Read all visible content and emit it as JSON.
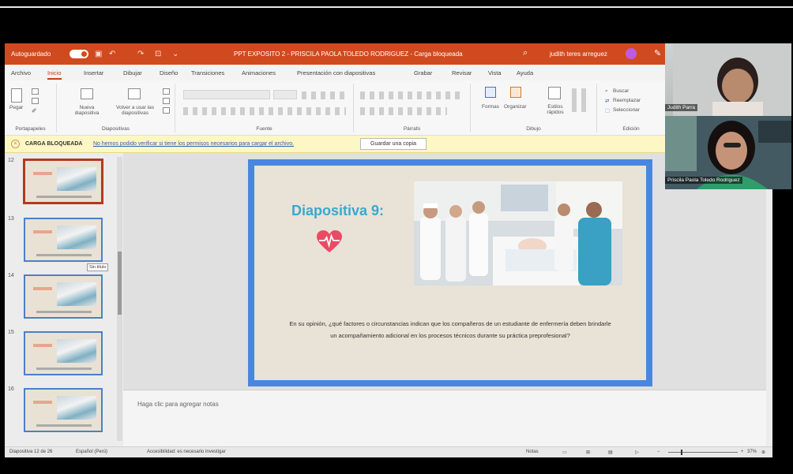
{
  "window": {
    "autosave_label": "Autoguardado",
    "doc_title": "PPT EXPOSITO 2 - PRISCILA PAOLA TOLEDO RODRIGUEZ - Carga bloqueada",
    "user_name": "judith teres arreguez"
  },
  "tabs": [
    "Archivo",
    "Inicio",
    "Insertar",
    "Dibujar",
    "Diseño",
    "Transiciones",
    "Animaciones",
    "Presentación con diapositivas",
    "Grabar",
    "Revisar",
    "Vista",
    "Ayuda"
  ],
  "ribbon": {
    "paste_label": "Pegar",
    "new_slide_label": "Nueva diapositiva",
    "reuse_label": "Volver a usar las diapositivas",
    "forms_label": "Formas",
    "arrange_label": "Organizar",
    "quick_styles_label": "Estilos rápidos",
    "find_label": "Buscar",
    "replace_label": "Reemplazar",
    "select_label": "Seleccionar",
    "groups": {
      "clipboard": "Portapapeles",
      "slides": "Diapositivas",
      "font": "Fuente",
      "paragraph": "Párrafo",
      "drawing": "Dibujo",
      "editing": "Edición"
    }
  },
  "infobar": {
    "head": "CARGA BLOQUEADA",
    "message": "No hemos podido verificar si tiene los permisos necesarios para cargar el archivo.",
    "button": "Guardar una copia"
  },
  "thumbnails": {
    "numbers": [
      "12",
      "13",
      "14",
      "15",
      "16"
    ],
    "selected_number": "12",
    "tooltip": "Sin título"
  },
  "slide": {
    "title": "Diapositiva 9:",
    "body": "En su opinión, ¿qué factores o circunstancias indican que los compañeros de un estudiante de enfermería deben brindarle un acompañamiento adicional en los procesos técnicos durante su práctica preprofesional?"
  },
  "notes": {
    "placeholder": "Haga clic para agregar notas"
  },
  "statusbar": {
    "slide_info": "Diapositiva 12 de 26",
    "language": "Español (Perú)",
    "accessibility": "Accesibilidad: es necesario investigar",
    "notes_btn": "Notas",
    "zoom": "37%"
  },
  "video": {
    "participant1": "Judith Parra",
    "participant2": "Priscila Paola Toledo Rodriguez"
  },
  "colors": {
    "accent": "#d04a1f",
    "slide_frame": "#4a86e0",
    "slide_title": "#3aa8cf",
    "heart": "#e94b63"
  }
}
